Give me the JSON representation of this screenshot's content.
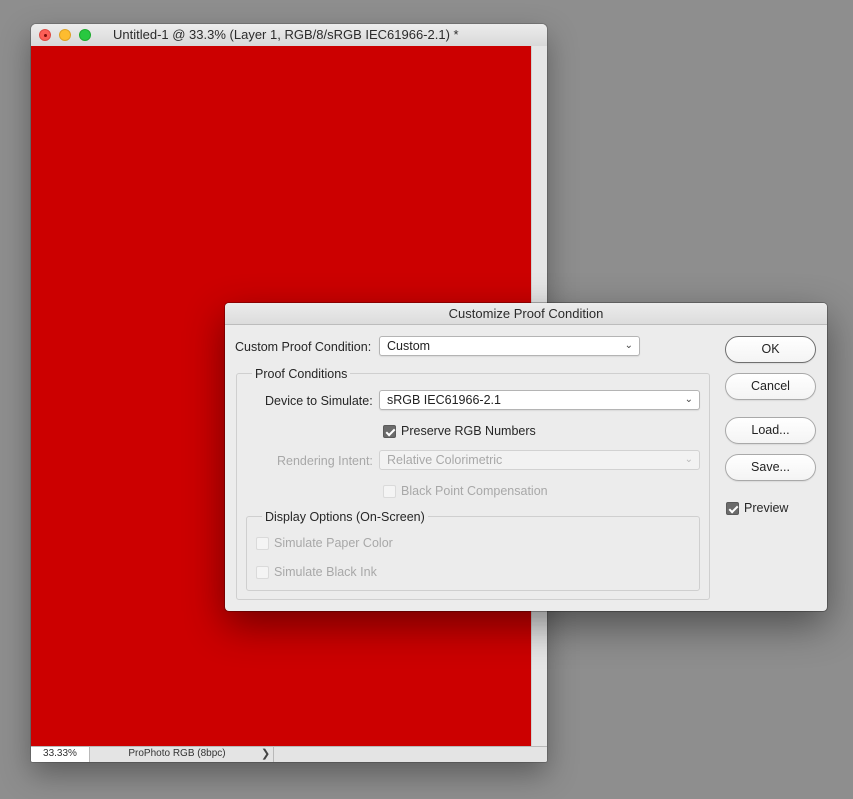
{
  "document_window": {
    "title": "Untitled-1 @ 33.3% (Layer 1, RGB/8/sRGB IEC61966-2.1) *",
    "canvas_color": "#cc0000",
    "status": {
      "zoom": "33.33%",
      "doc_info": "ProPhoto RGB (8bpc)",
      "arrow": "❯"
    }
  },
  "dialog": {
    "title": "Customize Proof Condition",
    "custom_proof_condition": {
      "label": "Custom Proof Condition:",
      "value": "Custom"
    },
    "proof_conditions": {
      "group_title": "Proof Conditions",
      "device_to_simulate": {
        "label": "Device to Simulate:",
        "value": "sRGB IEC61966-2.1"
      },
      "preserve_rgb": {
        "label": "Preserve RGB Numbers",
        "checked": true
      },
      "rendering_intent": {
        "label": "Rendering Intent:",
        "value": "Relative Colorimetric",
        "disabled": true
      },
      "black_point": {
        "label": "Black Point Compensation",
        "checked": false,
        "disabled": true
      }
    },
    "display_options": {
      "group_title": "Display Options (On-Screen)",
      "simulate_paper": {
        "label": "Simulate Paper Color",
        "checked": false,
        "disabled": true
      },
      "simulate_black_ink": {
        "label": "Simulate Black Ink",
        "checked": false,
        "disabled": true
      }
    },
    "buttons": {
      "ok": "OK",
      "cancel": "Cancel",
      "load": "Load...",
      "save": "Save..."
    },
    "preview": {
      "label": "Preview",
      "checked": true
    }
  },
  "icons": {
    "chevron": "⌄"
  }
}
